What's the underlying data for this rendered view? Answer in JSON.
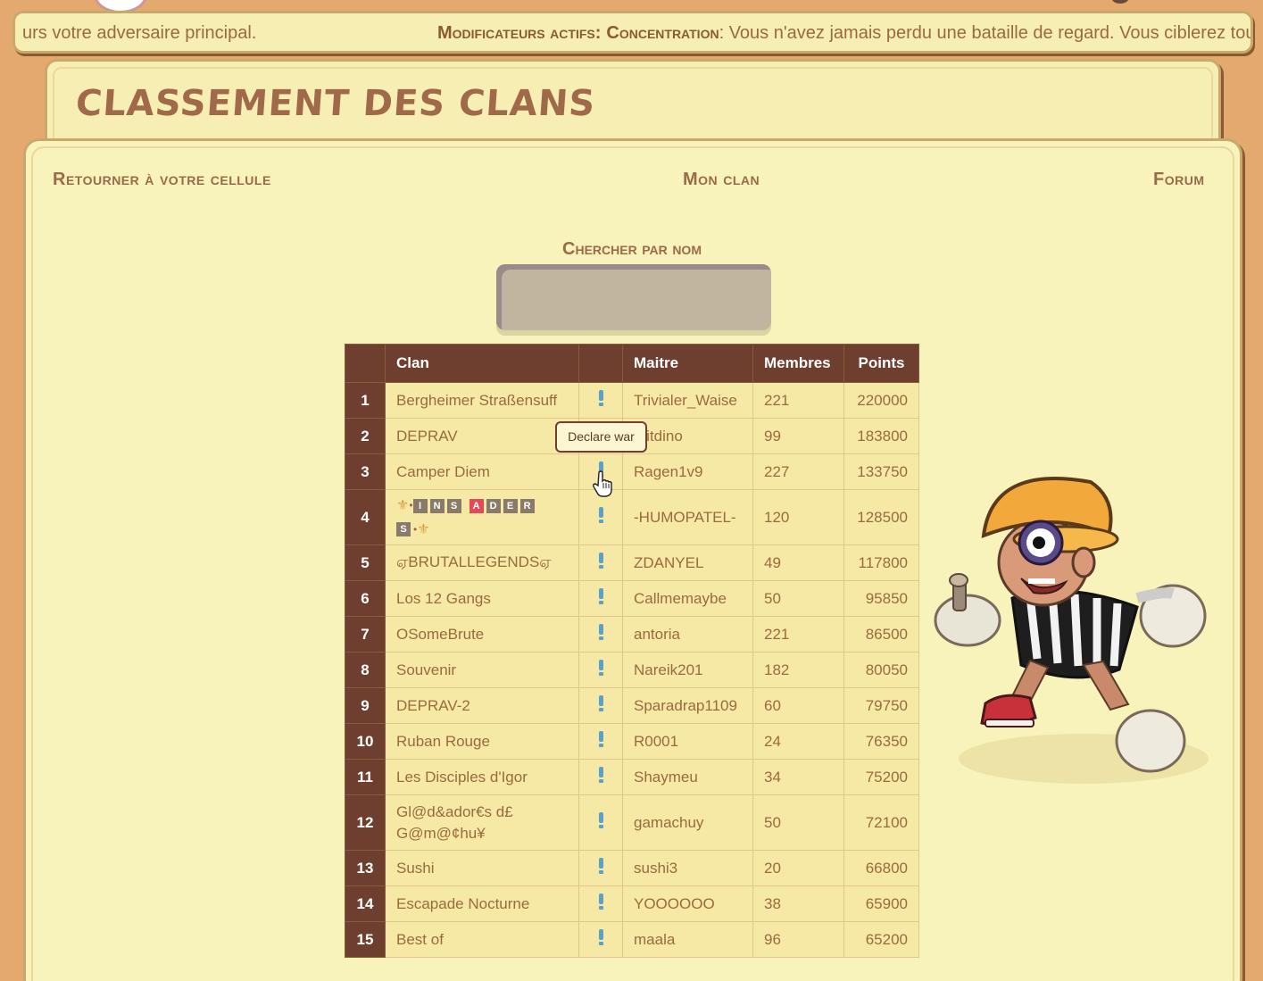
{
  "ticker": {
    "left_text": "urs votre adversaire principal.",
    "mod_label": "Modificateurs actifs:",
    "mod_name": "Concentration",
    "mod_text": ": Vous n'avez jamais perdu une bataille de regard. Vous ciblerez toujou"
  },
  "title": "CLASSEMENT DES CLANS",
  "nav": {
    "back": "Retourner à votre cellule",
    "my_clan": "Mon clan",
    "forum": "Forum"
  },
  "search": {
    "label": "Chercher par nom",
    "placeholder": ""
  },
  "table": {
    "headers": {
      "rank": "",
      "clan": "Clan",
      "action": "",
      "master": "Maitre",
      "members": "Membres",
      "points": "Points"
    },
    "rows": [
      {
        "rank": "1",
        "clan": "Bergheimer Straßensuff",
        "master": "Trivialer_Waise",
        "members": "221",
        "points": "220000"
      },
      {
        "rank": "2",
        "clan": "DEPRAV",
        "master": "ptitdino",
        "members": "99",
        "points": "183800"
      },
      {
        "rank": "3",
        "clan": "Camper Diem",
        "master": "Ragen1v9",
        "members": "227",
        "points": "133750"
      },
      {
        "rank": "4",
        "clan": "",
        "master": "-HUMOPATEL-",
        "members": "120",
        "points": "128500"
      },
      {
        "rank": "5",
        "clan": "ஏBRUTALLEGENDSஏ",
        "master": "ZDANYEL",
        "members": "49",
        "points": "117800"
      },
      {
        "rank": "6",
        "clan": "Los 12 Gangs",
        "master": "Callmemaybe",
        "members": "50",
        "points": "95850"
      },
      {
        "rank": "7",
        "clan": "OSomeBrute",
        "master": "antoria",
        "members": "221",
        "points": "86500"
      },
      {
        "rank": "8",
        "clan": "Souvenir",
        "master": "Nareik201",
        "members": "182",
        "points": "80050"
      },
      {
        "rank": "9",
        "clan": "DEPRAV-2",
        "master": "Sparadrap1109",
        "members": "60",
        "points": "79750"
      },
      {
        "rank": "10",
        "clan": "Ruban Rouge",
        "master": "R0001",
        "members": "24",
        "points": "76350"
      },
      {
        "rank": "11",
        "clan": "Les Disciples d'Igor",
        "master": "Shaymeu",
        "members": "34",
        "points": "75200"
      },
      {
        "rank": "12",
        "clan": "Gl@d&ador€s d£ G@m@¢hu¥",
        "master": "gamachuy",
        "members": "50",
        "points": "72100"
      },
      {
        "rank": "13",
        "clan": "Sushi",
        "master": "sushi3",
        "members": "20",
        "points": "66800"
      },
      {
        "rank": "14",
        "clan": "Escapade Nocturne",
        "master": "YOOOOOO",
        "members": "38",
        "points": "65900"
      },
      {
        "rank": "15",
        "clan": "Best of",
        "master": "maala",
        "members": "96",
        "points": "65200"
      }
    ],
    "clan4_flair": {
      "letters": [
        "I",
        "N",
        "S",
        "A",
        "D",
        "E",
        "R",
        "S"
      ],
      "highlight_letter_index": 3,
      "accent_color": "#e04a5a"
    }
  },
  "tooltip": "Declare war",
  "icons": {
    "declare_war": "exclamation-icon",
    "cursor": "hand-pointer-icon"
  },
  "colors": {
    "background": "#e3a96e",
    "card": "#f8f2bb",
    "table_header": "#6e3f2e",
    "table_cell": "#f6e9a5",
    "text_brown": "#9a6a3f",
    "war_icon": "#5aa0c8"
  }
}
